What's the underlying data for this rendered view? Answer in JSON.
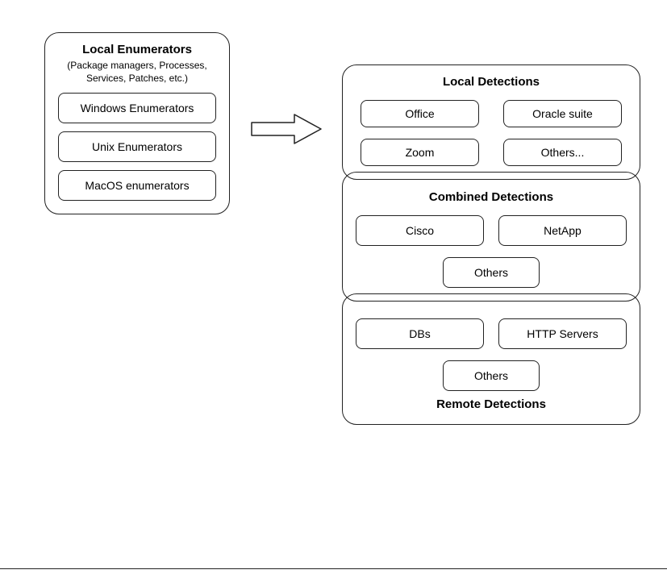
{
  "enumerators": {
    "title": "Local Enumerators",
    "subtitle": "(Package managers, Processes, Services, Patches, etc.)",
    "items": [
      "Windows Enumerators",
      "Unix Enumerators",
      "MacOS enumerators"
    ]
  },
  "local_detections": {
    "title": "Local Detections",
    "row1": [
      "Office",
      "Oracle suite"
    ],
    "row2": [
      "Zoom",
      "Others..."
    ]
  },
  "combined_detections": {
    "title": "Combined Detections",
    "row1": [
      "Cisco",
      "NetApp"
    ],
    "row2": [
      "Others"
    ]
  },
  "remote_detections": {
    "title": "Remote Detections",
    "row1": [
      "DBs",
      "HTTP Servers"
    ],
    "row2": [
      "Others"
    ]
  }
}
